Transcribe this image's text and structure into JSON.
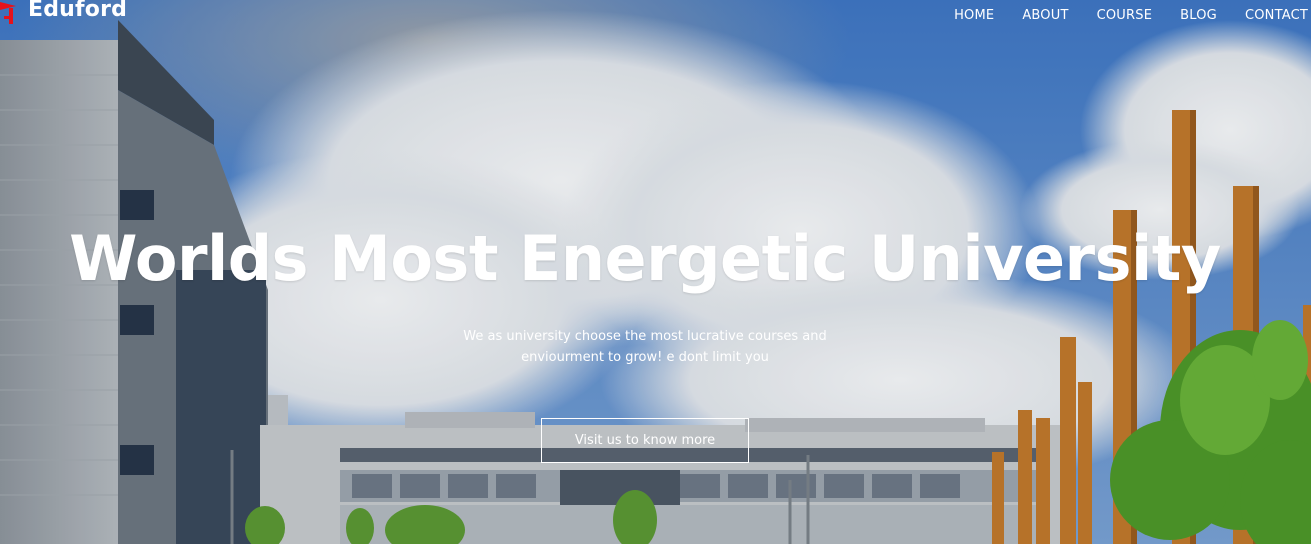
{
  "brand": {
    "name": "Eduford",
    "logo_icon": "mortarboard-logo-icon",
    "logo_color": "#e6121b"
  },
  "nav": {
    "items": [
      {
        "label": "HOME"
      },
      {
        "label": "ABOUT"
      },
      {
        "label": "COURSE"
      },
      {
        "label": "BLOG"
      },
      {
        "label": "CONTACT"
      }
    ]
  },
  "hero": {
    "title": "Worlds Most Energetic University",
    "subtitle_line1": "We as university choose the most lucrative courses and",
    "subtitle_line2": "enviourment to grow! e dont limit you",
    "cta_label": "Visit us to know more",
    "background": "campus-building-photo",
    "colors": {
      "sky": "#4f86cc",
      "cloud": "#eef2f6",
      "pillar": "#c87a2a",
      "tree": "#4f9a2c"
    }
  }
}
